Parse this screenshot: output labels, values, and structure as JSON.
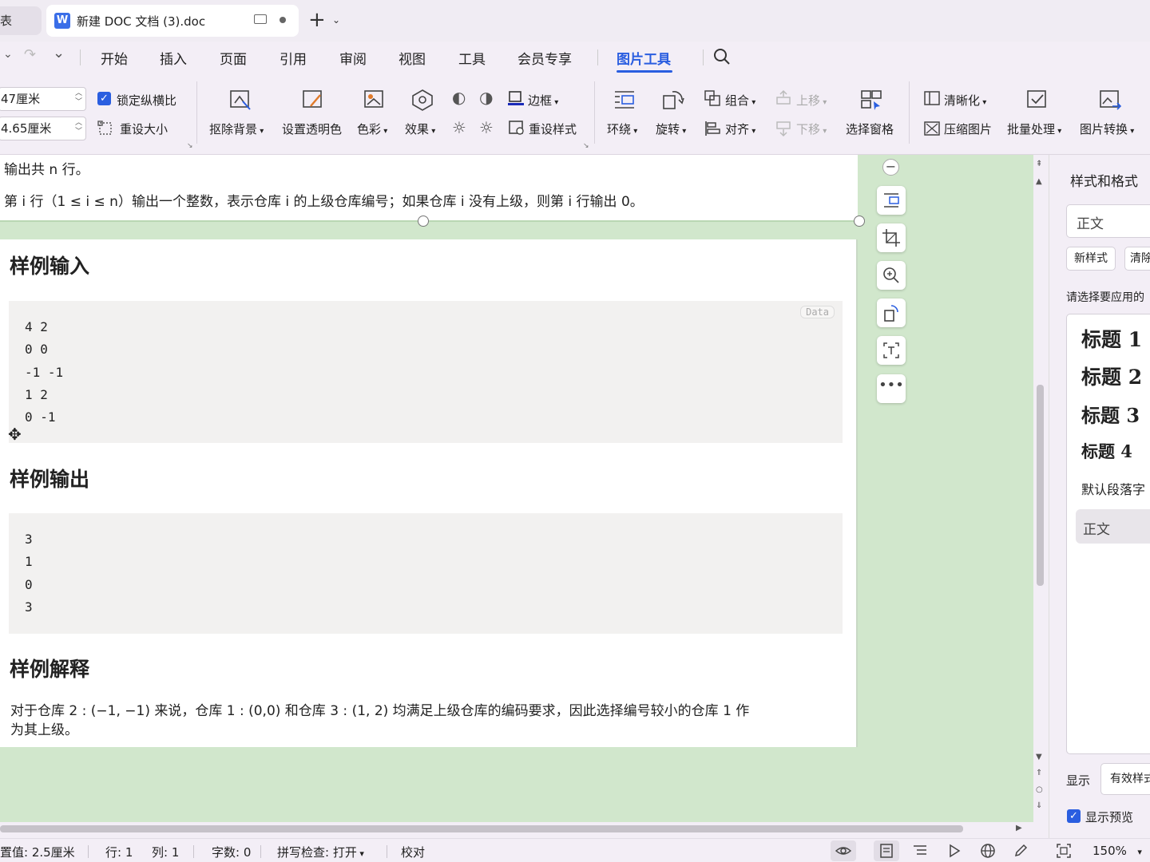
{
  "tabs": {
    "prev_tab_label": "表",
    "doc_tab_title": "新建 DOC 文档 (3).doc",
    "doc_logo": "W",
    "new_tab": "+"
  },
  "menu": {
    "items": [
      "开始",
      "插入",
      "页面",
      "引用",
      "审阅",
      "视图",
      "工具",
      "会员专享",
      "图片工具"
    ],
    "active": "图片工具"
  },
  "ribbon": {
    "width_value": "47厘米",
    "height_value": "4.65厘米",
    "lock_ratio": "锁定纵横比",
    "reset_size": "重设大小",
    "remove_bg": "抠除背景",
    "set_transparent": "设置透明色",
    "color": "色彩",
    "effect": "效果",
    "border": "边框",
    "reset_style": "重设样式",
    "wrap": "环绕",
    "rotate": "旋转",
    "group": "组合",
    "align": "对齐",
    "bring_forward": "上移",
    "send_backward": "下移",
    "selection_pane": "选择窗格",
    "sharpen": "清晰化",
    "compress": "压缩图片",
    "batch": "批量处理",
    "convert": "图片转换"
  },
  "document": {
    "line1": "输出共 n 行。",
    "line2": "第 i 行（1 ≤ i ≤ n）输出一个整数，表示仓库 i 的上级仓库编号；如果仓库 i 没有上级，则第 i 行输出 0。",
    "sample_input_heading": "样例输入",
    "data_tag": "Data",
    "sample_input_lines": [
      "4 2",
      "0 0",
      "-1 -1",
      "1 2",
      "0 -1"
    ],
    "sample_output_heading": "样例输出",
    "sample_output_lines": [
      "3",
      "1",
      "0",
      "3"
    ],
    "explain_heading": "样例解释",
    "explain_line1": "对于仓库 2 : (−1, −1) 来说，仓库 1 : (0,0) 和仓库 3 : (1, 2) 均满足上级仓库的编码要求，因此选择编号较小的仓库 1 作",
    "explain_line2": "为其上级。"
  },
  "styles_panel": {
    "title": "样式和格式",
    "current_style": "正文",
    "new_style": "新样式",
    "clear": "清除",
    "prompt": "请选择要应用的",
    "styles": [
      "标题 1",
      "标题 2",
      "标题 3",
      "标题 4"
    ],
    "default_para": "默认段落字",
    "body": "正文",
    "show_label": "显示",
    "show_value": "有效样式",
    "preview_label": "显示预览"
  },
  "status": {
    "position": "置值: 2.5厘米",
    "line": "行: 1",
    "column": "列: 1",
    "word_count": "字数: 0",
    "spell_check": "拼写检查: 打开",
    "proofread": "校对",
    "zoom": "150%"
  },
  "colors": {
    "accent": "#2a5ee0",
    "doc_background": "#d1e7cc",
    "chrome": "#f3eef6"
  }
}
